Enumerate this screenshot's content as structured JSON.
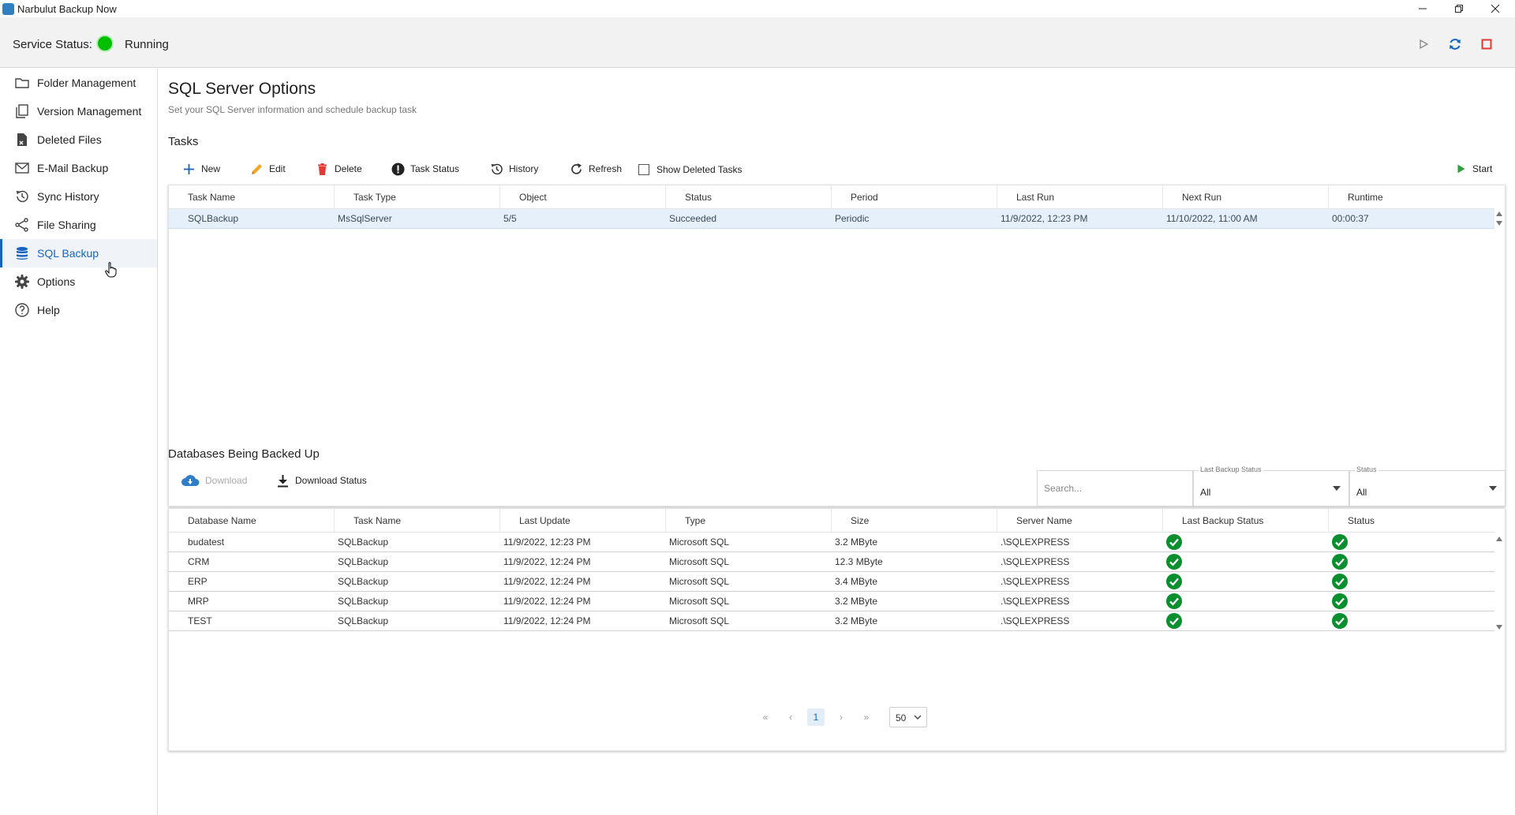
{
  "window": {
    "title": "Narbulut Backup Now"
  },
  "service": {
    "label": "Service Status:",
    "status": "Running",
    "status_color": "#00c000"
  },
  "sidebar": {
    "items": [
      {
        "label": "Folder Management",
        "icon": "folder-icon"
      },
      {
        "label": "Version Management",
        "icon": "versions-icon"
      },
      {
        "label": "Deleted Files",
        "icon": "deleted-file-icon"
      },
      {
        "label": "E-Mail Backup",
        "icon": "mail-icon"
      },
      {
        "label": "Sync History",
        "icon": "history-icon"
      },
      {
        "label": "File Sharing",
        "icon": "share-icon"
      },
      {
        "label": "SQL Backup",
        "icon": "database-icon",
        "active": true
      },
      {
        "label": "Options",
        "icon": "gear-icon"
      },
      {
        "label": "Help",
        "icon": "help-icon"
      }
    ]
  },
  "page": {
    "title": "SQL Server Options",
    "subtitle": "Set your SQL Server information and schedule backup task"
  },
  "tasks": {
    "section_title": "Tasks",
    "toolbar": {
      "new": "New",
      "edit": "Edit",
      "delete": "Delete",
      "task_status": "Task Status",
      "history": "History",
      "refresh": "Refresh",
      "show_deleted": "Show Deleted Tasks",
      "start": "Start"
    },
    "columns": [
      "Task Name",
      "Task Type",
      "Object",
      "Status",
      "Period",
      "Last Run",
      "Next Run",
      "Runtime"
    ],
    "rows": [
      [
        "SQLBackup",
        "MsSqlServer",
        "5/5",
        "Succeeded",
        "Periodic",
        "11/9/2022, 12:23 PM",
        "11/10/2022, 11:00 AM",
        "00:00:37"
      ]
    ]
  },
  "databases": {
    "section_title": "Databases Being Backed Up",
    "toolbar": {
      "download": "Download",
      "download_status": "Download Status"
    },
    "filters": {
      "search_placeholder": "Search...",
      "last_backup_status_label": "Last Backup Status",
      "last_backup_status_value": "All",
      "status_label": "Status",
      "status_value": "All"
    },
    "columns": [
      "Database Name",
      "Task Name",
      "Last Update",
      "Type",
      "Size",
      "Server Name",
      "Last Backup Status",
      "Status"
    ],
    "rows": [
      [
        "budatest",
        "SQLBackup",
        "11/9/2022, 12:23 PM",
        "Microsoft SQL",
        "3.2 MByte",
        ".\\SQLEXPRESS"
      ],
      [
        "CRM",
        "SQLBackup",
        "11/9/2022, 12:24 PM",
        "Microsoft SQL",
        "12.3 MByte",
        ".\\SQLEXPRESS"
      ],
      [
        "ERP",
        "SQLBackup",
        "11/9/2022, 12:24 PM",
        "Microsoft SQL",
        "3.4 MByte",
        ".\\SQLEXPRESS"
      ],
      [
        "MRP",
        "SQLBackup",
        "11/9/2022, 12:24 PM",
        "Microsoft SQL",
        "3.2 MByte",
        ".\\SQLEXPRESS"
      ],
      [
        "TEST",
        "SQLBackup",
        "11/9/2022, 12:24 PM",
        "Microsoft SQL",
        "3.2 MByte",
        ".\\SQLEXPRESS"
      ]
    ],
    "pager": {
      "current_page": "1",
      "page_size": "50"
    }
  },
  "colors": {
    "accent": "#1565c0",
    "success": "#0a8f2e",
    "danger": "#e53935"
  }
}
